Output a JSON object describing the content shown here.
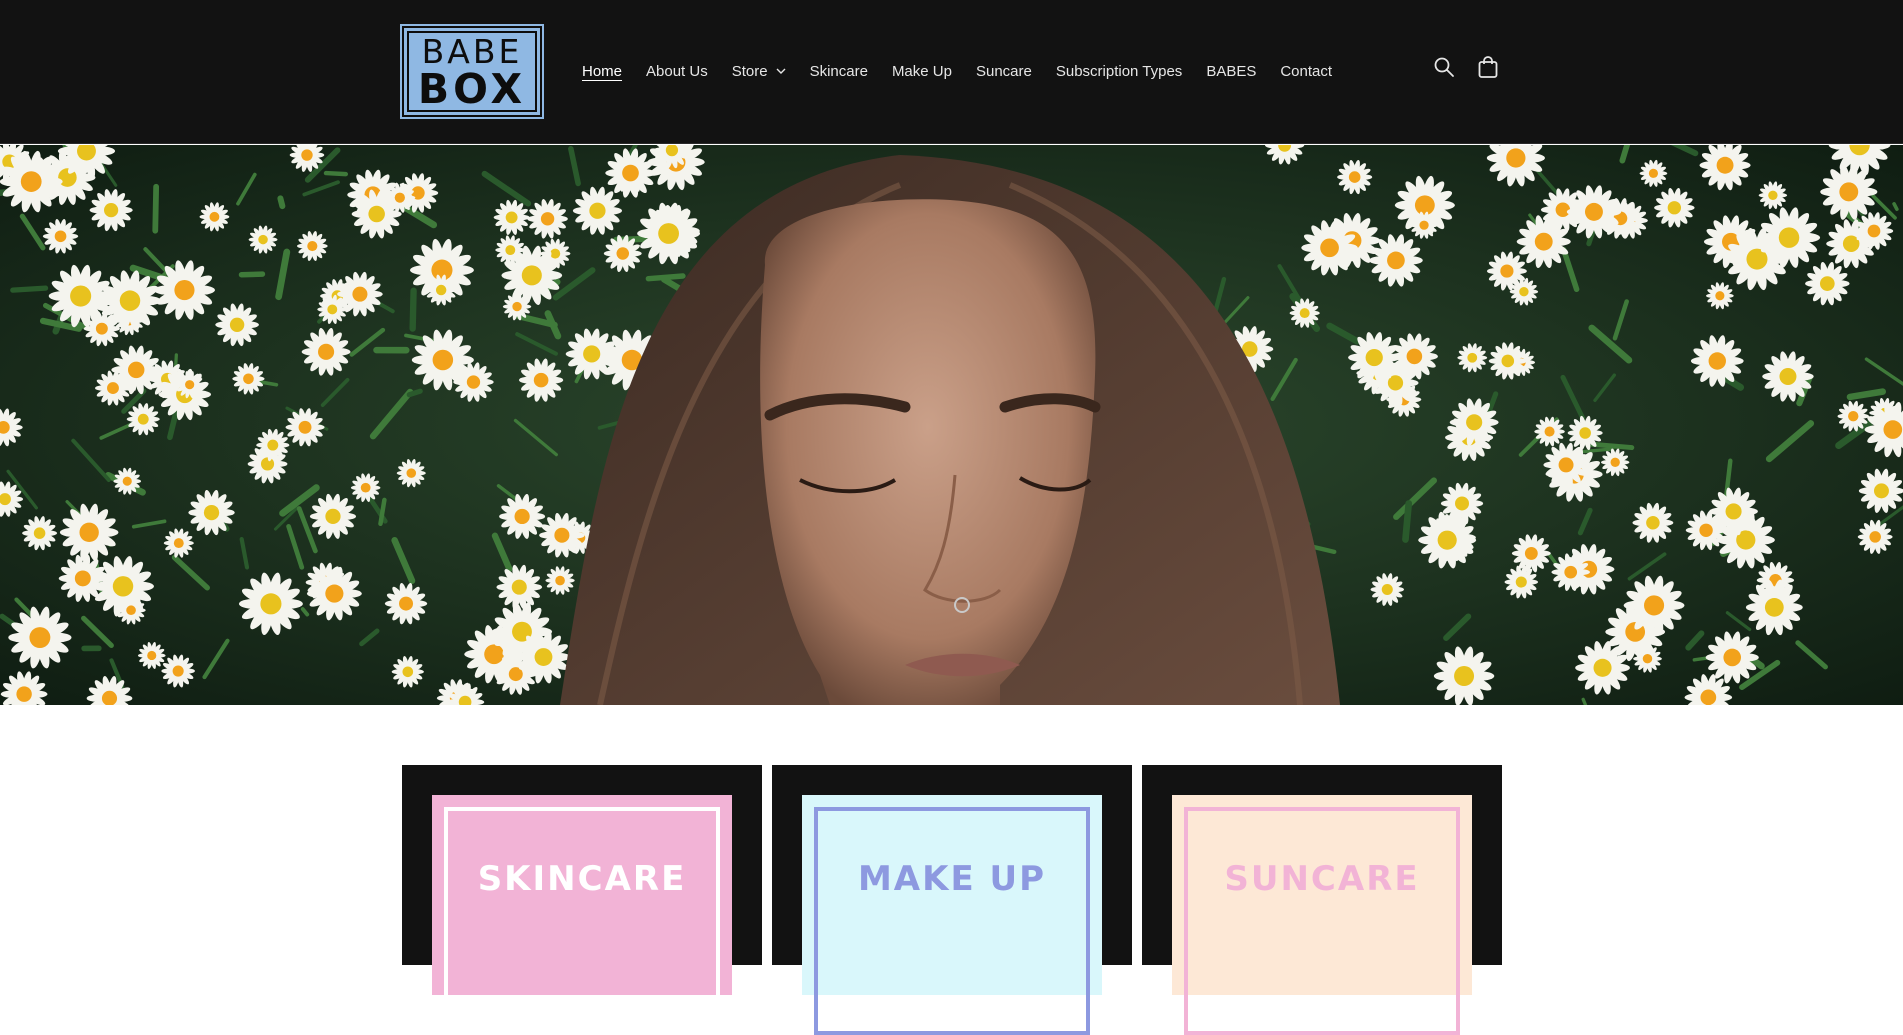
{
  "header": {
    "logo": {
      "line1": "BABE",
      "line2": "BOX"
    },
    "nav": [
      {
        "label": "Home",
        "active": true
      },
      {
        "label": "About Us"
      },
      {
        "label": "Store",
        "has_dropdown": true
      },
      {
        "label": "Skincare"
      },
      {
        "label": "Make Up"
      },
      {
        "label": "Suncare"
      },
      {
        "label": "Subscription Types"
      },
      {
        "label": "BABES"
      },
      {
        "label": "Contact"
      }
    ],
    "icons": [
      "search-icon",
      "cart-icon"
    ]
  },
  "hero": {
    "image": "woman-lying-in-daisies"
  },
  "collections": [
    {
      "title": "SKINCARE",
      "bg": "#f2b3d6",
      "accent": "#ffffff"
    },
    {
      "title": "MAKE UP",
      "bg": "#d9f7fb",
      "accent": "#8d99e0"
    },
    {
      "title": "SUNCARE",
      "bg": "#fde8d6",
      "accent": "#f2b3d6"
    }
  ],
  "colors": {
    "header_bg": "#121212",
    "logo_bg": "#8fb8e3",
    "card_bg": "#121212"
  }
}
